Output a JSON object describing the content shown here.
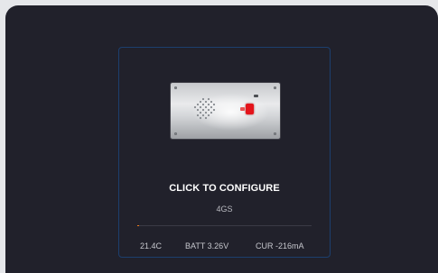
{
  "device_card": {
    "title": "CLICK TO CONFIGURE",
    "subtitle": "4GS",
    "progress": 0.01,
    "progress_color": "#f07b1a",
    "image_icon": "intercom-device-icon",
    "stats": {
      "temperature": "21.4C",
      "battery": "BATT 3.26V",
      "current": "CUR -216mA"
    }
  },
  "colors": {
    "background": "#21212b",
    "card_border": "#1c3f6e",
    "accent": "#e4141b"
  }
}
